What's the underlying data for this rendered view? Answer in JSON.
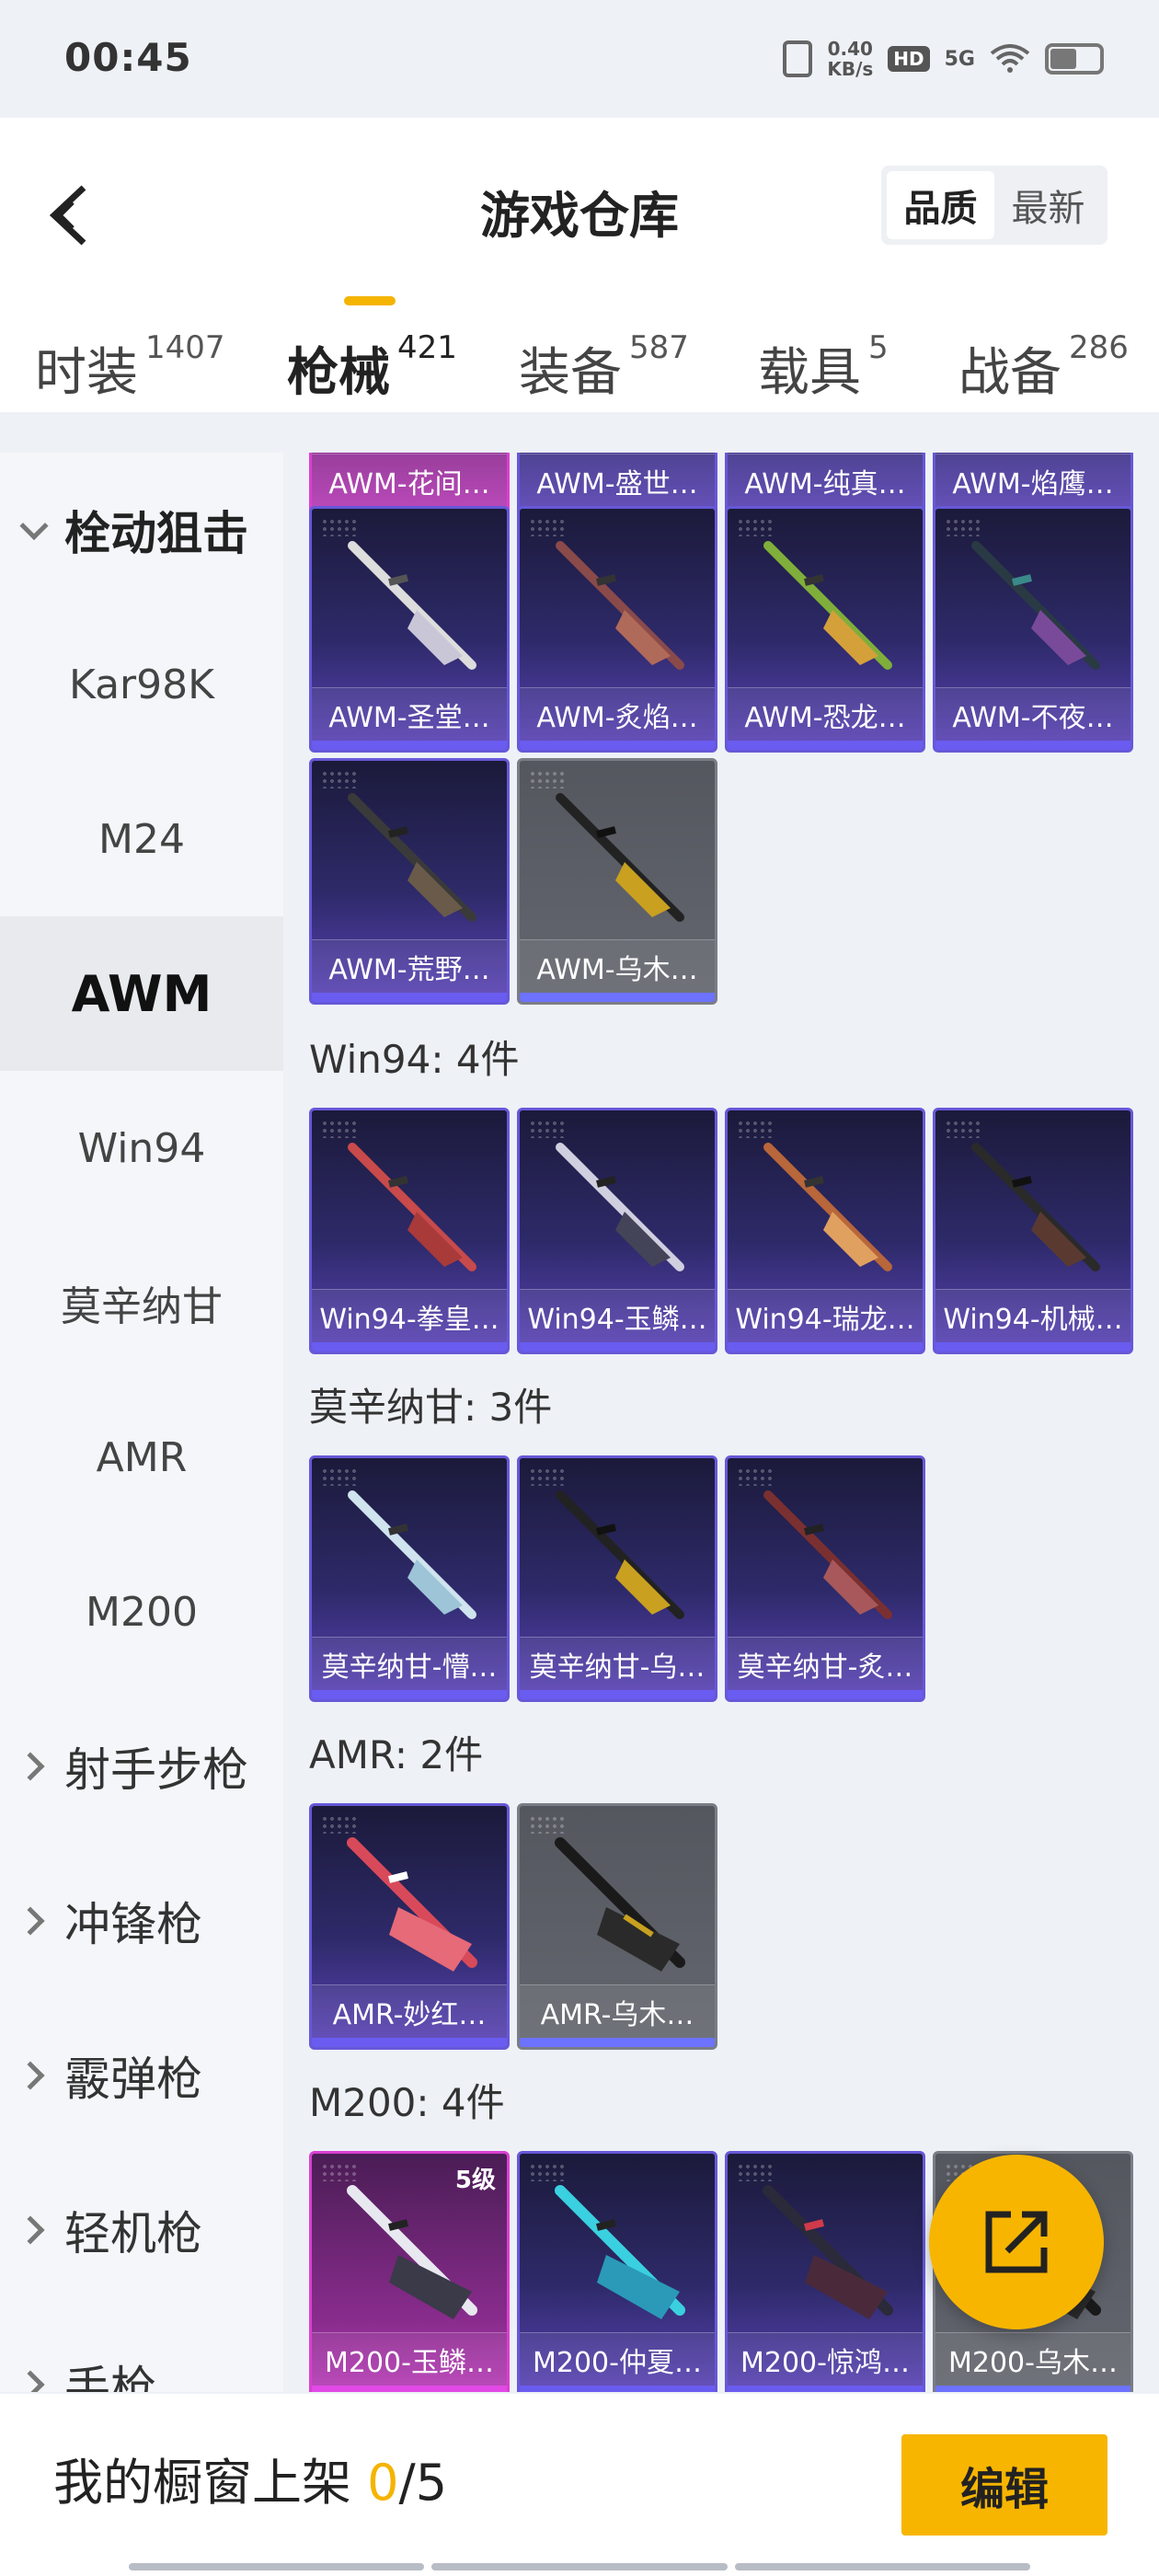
{
  "status_bar": {
    "time": "00:45",
    "net_speed_value": "0.40",
    "net_speed_unit": "KB/s",
    "hd": "HD",
    "network": "5G"
  },
  "header": {
    "title": "游戏仓库",
    "sort_options": [
      "品质",
      "最新"
    ],
    "sort_active": "品质"
  },
  "tabs": [
    {
      "label": "时装",
      "count": "1407"
    },
    {
      "label": "枪械",
      "count": "421",
      "active": true
    },
    {
      "label": "装备",
      "count": "587"
    },
    {
      "label": "载具",
      "count": "5"
    },
    {
      "label": "战备",
      "count": "286"
    }
  ],
  "sidebar": {
    "group_open": "栓动狙击",
    "items": [
      "Kar98K",
      "M24",
      "AWM",
      "Win94",
      "莫辛纳甘",
      "AMR",
      "M200"
    ],
    "active": "AWM",
    "groups": [
      "射手步枪",
      "冲锋枪",
      "霰弹枪",
      "轻机枪",
      "手枪"
    ]
  },
  "sections": {
    "awm_top_row": [
      "AWM-花间…",
      "AWM-盛世…",
      "AWM-纯真…",
      "AWM-焰鹰…"
    ],
    "awm_row2": [
      "AWM-圣堂…",
      "AWM-炙焰…",
      "AWM-恐龙…",
      "AWM-不夜…"
    ],
    "awm_row3": [
      "AWM-荒野…",
      "AWM-乌木…"
    ],
    "win94": {
      "title": "Win94: 4件",
      "items": [
        "Win94-拳皇…",
        "Win94-玉鳞…",
        "Win94-瑞龙…",
        "Win94-机械…"
      ]
    },
    "mosin": {
      "title": "莫辛纳甘: 3件",
      "items": [
        "莫辛纳甘-懵…",
        "莫辛纳甘-乌…",
        "莫辛纳甘-炙…"
      ]
    },
    "amr": {
      "title": "AMR: 2件",
      "items": [
        "AMR-妙红…",
        "AMR-乌木…"
      ]
    },
    "m200": {
      "title": "M200: 4件",
      "items": [
        "M200-玉鳞…",
        "M200-仲夏…",
        "M200-惊鸿…",
        "M200-乌木…"
      ],
      "level_badge": "5级"
    }
  },
  "bottom": {
    "label": "我的橱窗上架 ",
    "current": "0",
    "total": "/5",
    "edit_label": "编辑"
  },
  "colors": {
    "accent": "#f7b500",
    "purple_border": "#6658d8",
    "pink_border": "#d940d0"
  }
}
